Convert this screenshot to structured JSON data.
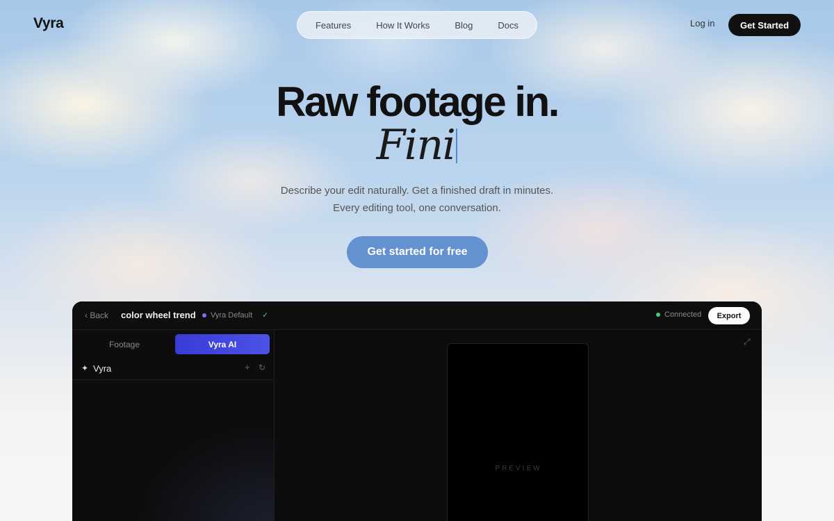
{
  "header": {
    "logo": "Vyra",
    "nav": [
      "Features",
      "How It Works",
      "Blog",
      "Docs"
    ],
    "login_label": "Log in",
    "cta_label": "Get Started"
  },
  "hero": {
    "title": "Raw footage in.",
    "subtitle_typed": "Fini",
    "desc_line1": "Describe your edit naturally. Get a finished draft in minutes.",
    "desc_line2": "Every editing tool, one conversation.",
    "cta_label": "Get started for free",
    "cta_color": "#6491d0"
  },
  "app": {
    "back_label": "Back",
    "project_name": "color wheel trend",
    "preset_name": "Vyra Default",
    "status_label": "Connected",
    "export_label": "Export",
    "tabs": {
      "footage": "Footage",
      "ai": "Vyra AI"
    },
    "panel_title": "Vyra",
    "preview_label": "PREVIEW",
    "accent_color": "#4b52e6",
    "status_color": "#49c86e"
  }
}
